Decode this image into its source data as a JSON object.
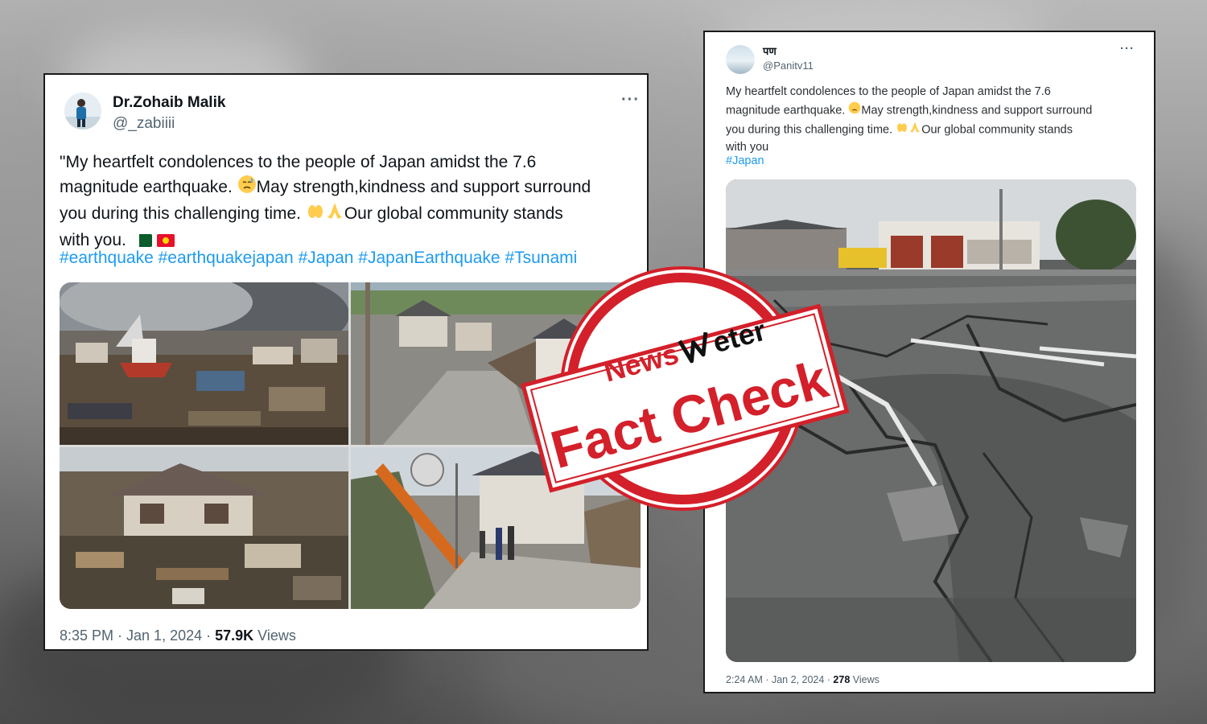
{
  "tweet1": {
    "display_name": "Dr.Zohaib Malik",
    "handle": "@_zabiiii",
    "text_line1": "\"My heartfelt condolences to the people of Japan amidst the 7.6",
    "text_line2_a": "magnitude earthquake. ",
    "text_line2_b": "May strength,kindness and support surround",
    "text_line3_a": "you during this challenging time. ",
    "text_line3_b": "Our global community stands",
    "text_line4": "with you.",
    "hashtags": "#earthquake #earthquakejapan #Japan #JapanEarthquake #Tsunami",
    "time": "8:35 PM · Jan 1, 2024 · ",
    "views_count": "57.9K",
    "views_label": " Views"
  },
  "tweet2": {
    "display_name": "पण",
    "handle": "@Panitv11",
    "text_line1": "My heartfelt condolences to the people of Japan amidst the 7.6",
    "text_line2_a": "magnitude earthquake. ",
    "text_line2_b": "May strength,kindness and support surround",
    "text_line3_a": "you during this challenging time. ",
    "text_line3_b": "Our global community stands",
    "text_line4": "with you",
    "hashtag": "#Japan",
    "time": "2:24 AM · Jan 2, 2024 · ",
    "views_count": "278",
    "views_label": " Views"
  },
  "stamp": {
    "brand_news": "News",
    "brand_meter": "eter",
    "label": "Fact Check"
  },
  "colors": {
    "stamp_red": "#d3202a",
    "link_blue": "#1d9bf0",
    "text_dark": "#0f1419",
    "text_gray": "#536471"
  },
  "icons": {
    "more": "more-options-icon",
    "checkmark": "checkmark-icon"
  }
}
